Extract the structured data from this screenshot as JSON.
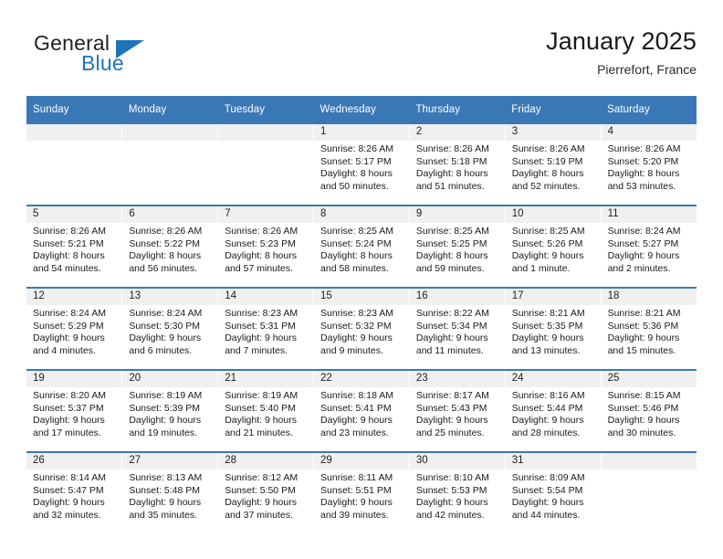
{
  "brand": {
    "name_top": "General",
    "name_bottom": "Blue",
    "accent_color": "#1d74bb"
  },
  "header": {
    "title": "January 2025",
    "location": "Pierrefort, France"
  },
  "calendar": {
    "header_bg": "#3a78b5",
    "daynum_bg": "#f0f0f0",
    "weekday_headers": [
      "Sunday",
      "Monday",
      "Tuesday",
      "Wednesday",
      "Thursday",
      "Friday",
      "Saturday"
    ],
    "weeks": [
      [
        {
          "day": "",
          "sunrise": "",
          "sunset": "",
          "daylight1": "",
          "daylight2": ""
        },
        {
          "day": "",
          "sunrise": "",
          "sunset": "",
          "daylight1": "",
          "daylight2": ""
        },
        {
          "day": "",
          "sunrise": "",
          "sunset": "",
          "daylight1": "",
          "daylight2": ""
        },
        {
          "day": "1",
          "sunrise": "Sunrise: 8:26 AM",
          "sunset": "Sunset: 5:17 PM",
          "daylight1": "Daylight: 8 hours",
          "daylight2": "and 50 minutes."
        },
        {
          "day": "2",
          "sunrise": "Sunrise: 8:26 AM",
          "sunset": "Sunset: 5:18 PM",
          "daylight1": "Daylight: 8 hours",
          "daylight2": "and 51 minutes."
        },
        {
          "day": "3",
          "sunrise": "Sunrise: 8:26 AM",
          "sunset": "Sunset: 5:19 PM",
          "daylight1": "Daylight: 8 hours",
          "daylight2": "and 52 minutes."
        },
        {
          "day": "4",
          "sunrise": "Sunrise: 8:26 AM",
          "sunset": "Sunset: 5:20 PM",
          "daylight1": "Daylight: 8 hours",
          "daylight2": "and 53 minutes."
        }
      ],
      [
        {
          "day": "5",
          "sunrise": "Sunrise: 8:26 AM",
          "sunset": "Sunset: 5:21 PM",
          "daylight1": "Daylight: 8 hours",
          "daylight2": "and 54 minutes."
        },
        {
          "day": "6",
          "sunrise": "Sunrise: 8:26 AM",
          "sunset": "Sunset: 5:22 PM",
          "daylight1": "Daylight: 8 hours",
          "daylight2": "and 56 minutes."
        },
        {
          "day": "7",
          "sunrise": "Sunrise: 8:26 AM",
          "sunset": "Sunset: 5:23 PM",
          "daylight1": "Daylight: 8 hours",
          "daylight2": "and 57 minutes."
        },
        {
          "day": "8",
          "sunrise": "Sunrise: 8:25 AM",
          "sunset": "Sunset: 5:24 PM",
          "daylight1": "Daylight: 8 hours",
          "daylight2": "and 58 minutes."
        },
        {
          "day": "9",
          "sunrise": "Sunrise: 8:25 AM",
          "sunset": "Sunset: 5:25 PM",
          "daylight1": "Daylight: 8 hours",
          "daylight2": "and 59 minutes."
        },
        {
          "day": "10",
          "sunrise": "Sunrise: 8:25 AM",
          "sunset": "Sunset: 5:26 PM",
          "daylight1": "Daylight: 9 hours",
          "daylight2": "and 1 minute."
        },
        {
          "day": "11",
          "sunrise": "Sunrise: 8:24 AM",
          "sunset": "Sunset: 5:27 PM",
          "daylight1": "Daylight: 9 hours",
          "daylight2": "and 2 minutes."
        }
      ],
      [
        {
          "day": "12",
          "sunrise": "Sunrise: 8:24 AM",
          "sunset": "Sunset: 5:29 PM",
          "daylight1": "Daylight: 9 hours",
          "daylight2": "and 4 minutes."
        },
        {
          "day": "13",
          "sunrise": "Sunrise: 8:24 AM",
          "sunset": "Sunset: 5:30 PM",
          "daylight1": "Daylight: 9 hours",
          "daylight2": "and 6 minutes."
        },
        {
          "day": "14",
          "sunrise": "Sunrise: 8:23 AM",
          "sunset": "Sunset: 5:31 PM",
          "daylight1": "Daylight: 9 hours",
          "daylight2": "and 7 minutes."
        },
        {
          "day": "15",
          "sunrise": "Sunrise: 8:23 AM",
          "sunset": "Sunset: 5:32 PM",
          "daylight1": "Daylight: 9 hours",
          "daylight2": "and 9 minutes."
        },
        {
          "day": "16",
          "sunrise": "Sunrise: 8:22 AM",
          "sunset": "Sunset: 5:34 PM",
          "daylight1": "Daylight: 9 hours",
          "daylight2": "and 11 minutes."
        },
        {
          "day": "17",
          "sunrise": "Sunrise: 8:21 AM",
          "sunset": "Sunset: 5:35 PM",
          "daylight1": "Daylight: 9 hours",
          "daylight2": "and 13 minutes."
        },
        {
          "day": "18",
          "sunrise": "Sunrise: 8:21 AM",
          "sunset": "Sunset: 5:36 PM",
          "daylight1": "Daylight: 9 hours",
          "daylight2": "and 15 minutes."
        }
      ],
      [
        {
          "day": "19",
          "sunrise": "Sunrise: 8:20 AM",
          "sunset": "Sunset: 5:37 PM",
          "daylight1": "Daylight: 9 hours",
          "daylight2": "and 17 minutes."
        },
        {
          "day": "20",
          "sunrise": "Sunrise: 8:19 AM",
          "sunset": "Sunset: 5:39 PM",
          "daylight1": "Daylight: 9 hours",
          "daylight2": "and 19 minutes."
        },
        {
          "day": "21",
          "sunrise": "Sunrise: 8:19 AM",
          "sunset": "Sunset: 5:40 PM",
          "daylight1": "Daylight: 9 hours",
          "daylight2": "and 21 minutes."
        },
        {
          "day": "22",
          "sunrise": "Sunrise: 8:18 AM",
          "sunset": "Sunset: 5:41 PM",
          "daylight1": "Daylight: 9 hours",
          "daylight2": "and 23 minutes."
        },
        {
          "day": "23",
          "sunrise": "Sunrise: 8:17 AM",
          "sunset": "Sunset: 5:43 PM",
          "daylight1": "Daylight: 9 hours",
          "daylight2": "and 25 minutes."
        },
        {
          "day": "24",
          "sunrise": "Sunrise: 8:16 AM",
          "sunset": "Sunset: 5:44 PM",
          "daylight1": "Daylight: 9 hours",
          "daylight2": "and 28 minutes."
        },
        {
          "day": "25",
          "sunrise": "Sunrise: 8:15 AM",
          "sunset": "Sunset: 5:46 PM",
          "daylight1": "Daylight: 9 hours",
          "daylight2": "and 30 minutes."
        }
      ],
      [
        {
          "day": "26",
          "sunrise": "Sunrise: 8:14 AM",
          "sunset": "Sunset: 5:47 PM",
          "daylight1": "Daylight: 9 hours",
          "daylight2": "and 32 minutes."
        },
        {
          "day": "27",
          "sunrise": "Sunrise: 8:13 AM",
          "sunset": "Sunset: 5:48 PM",
          "daylight1": "Daylight: 9 hours",
          "daylight2": "and 35 minutes."
        },
        {
          "day": "28",
          "sunrise": "Sunrise: 8:12 AM",
          "sunset": "Sunset: 5:50 PM",
          "daylight1": "Daylight: 9 hours",
          "daylight2": "and 37 minutes."
        },
        {
          "day": "29",
          "sunrise": "Sunrise: 8:11 AM",
          "sunset": "Sunset: 5:51 PM",
          "daylight1": "Daylight: 9 hours",
          "daylight2": "and 39 minutes."
        },
        {
          "day": "30",
          "sunrise": "Sunrise: 8:10 AM",
          "sunset": "Sunset: 5:53 PM",
          "daylight1": "Daylight: 9 hours",
          "daylight2": "and 42 minutes."
        },
        {
          "day": "31",
          "sunrise": "Sunrise: 8:09 AM",
          "sunset": "Sunset: 5:54 PM",
          "daylight1": "Daylight: 9 hours",
          "daylight2": "and 44 minutes."
        },
        {
          "day": "",
          "sunrise": "",
          "sunset": "",
          "daylight1": "",
          "daylight2": ""
        }
      ]
    ]
  }
}
